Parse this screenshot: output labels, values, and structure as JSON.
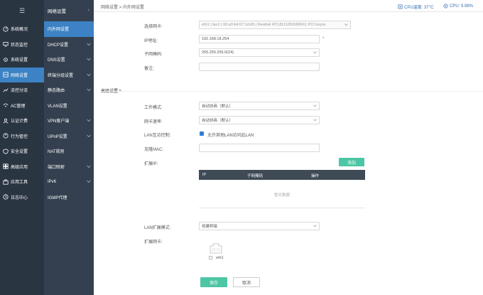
{
  "sidebar": {
    "items": [
      {
        "label": "系统概况",
        "icon": "dashboard-icon"
      },
      {
        "label": "状态监控",
        "icon": "monitor-icon"
      },
      {
        "label": "系统设置",
        "icon": "settings-icon"
      },
      {
        "label": "网络设置",
        "icon": "network-icon"
      },
      {
        "label": "流控分流",
        "icon": "flow-icon"
      },
      {
        "label": "AC管理",
        "icon": "ac-icon"
      },
      {
        "label": "认证计费",
        "icon": "auth-icon"
      },
      {
        "label": "行为管控",
        "icon": "behavior-icon"
      },
      {
        "label": "安全设置",
        "icon": "security-icon"
      },
      {
        "label": "高级应用",
        "icon": "advanced-icon"
      },
      {
        "label": "应用工具",
        "icon": "tools-icon"
      },
      {
        "label": "日志中心",
        "icon": "log-icon"
      }
    ]
  },
  "subnav": {
    "title": "网络设置",
    "items": [
      {
        "label": "内外网设置"
      },
      {
        "label": "DHCP设置"
      },
      {
        "label": "DNS设置"
      },
      {
        "label": "终端分组设置"
      },
      {
        "label": "静态路由"
      },
      {
        "label": "VLAN设置"
      },
      {
        "label": "VPN客户端"
      },
      {
        "label": "UPnP设置"
      },
      {
        "label": "NAT规则"
      },
      {
        "label": "端口映射"
      },
      {
        "label": "IPv6"
      },
      {
        "label": "IGMP代理"
      }
    ]
  },
  "topbar": {
    "breadcrumb": "网络设置 > 内外网设置",
    "cpu_temp": "CPU温度: 37°C",
    "cpu_usage": "CPU: 9.98%"
  },
  "form": {
    "nic_label": "选择网卡:",
    "nic_value": "eth1 | lan1 | 00:e0:b4:07:1d:d5 | Realtek RTL8111/8168/8411 PCI Expre",
    "ip_label": "IP地址:",
    "ip_value": "192.168.18.254",
    "required_mark": "*",
    "mask_label": "子网掩码:",
    "mask_value": "255.255.255.0(24)",
    "remark_label": "备注:",
    "remark_value": ""
  },
  "advanced": {
    "title": "高级设置 ^",
    "work_mode_label": "工作模式:",
    "work_mode_value": "自动协商（默认）",
    "nic_rate_label": "网卡速率:",
    "nic_rate_value": "自动协商（默认）",
    "lan_label": "LAN互访控制:",
    "lan_check_text": "允许其他LAN访问此LAN",
    "clone_mac_label": "克隆MAC:",
    "clone_mac_value": "",
    "extend_ip_label": "扩展IP:",
    "add_button": "添加",
    "table_headers": [
      "IP",
      "子网掩码",
      "操作"
    ],
    "empty_text": "暂无数据",
    "lan_ext_mode_label": "LAN扩展模式:",
    "lan_ext_mode_value": "创建桥接",
    "ext_nic_label": "扩展网卡:",
    "eth_name": "eth1"
  },
  "actions": {
    "save": "保存",
    "cancel": "取消"
  },
  "colors": {
    "sidebar_bg": "#2a3542",
    "subnav_bg": "#34404f",
    "active": "#3c82c4",
    "green": "#4cc6a4"
  }
}
